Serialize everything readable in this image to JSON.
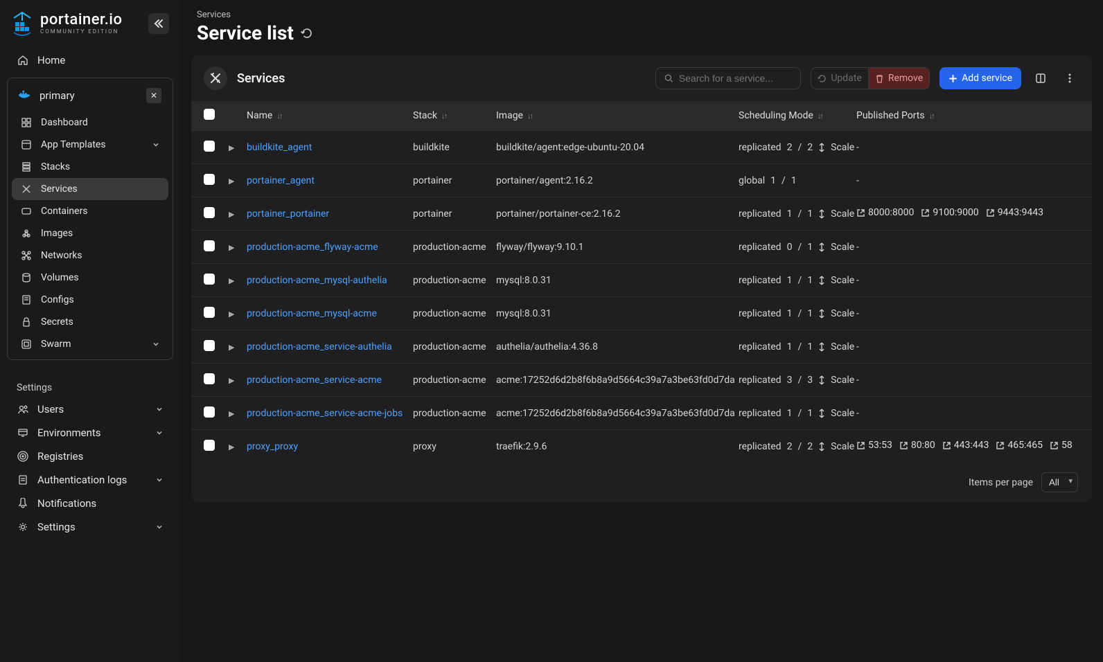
{
  "brand": {
    "name": "portainer.io",
    "tagline": "COMMUNITY EDITION"
  },
  "sidebar": {
    "home": "Home",
    "environment_name": "primary",
    "items": [
      {
        "label": "Dashboard"
      },
      {
        "label": "App Templates",
        "expandable": true
      },
      {
        "label": "Stacks"
      },
      {
        "label": "Services",
        "active": true
      },
      {
        "label": "Containers"
      },
      {
        "label": "Images"
      },
      {
        "label": "Networks"
      },
      {
        "label": "Volumes"
      },
      {
        "label": "Configs"
      },
      {
        "label": "Secrets"
      },
      {
        "label": "Swarm",
        "expandable": true
      }
    ],
    "settings_label": "Settings",
    "settings_items": [
      {
        "label": "Users",
        "expandable": true
      },
      {
        "label": "Environments",
        "expandable": true
      },
      {
        "label": "Registries"
      },
      {
        "label": "Authentication logs",
        "expandable": true
      },
      {
        "label": "Notifications"
      },
      {
        "label": "Settings",
        "expandable": true
      }
    ]
  },
  "breadcrumb": "Services",
  "page_title": "Service list",
  "panel": {
    "title": "Services",
    "search_placeholder": "Search for a service...",
    "update_label": "Update",
    "remove_label": "Remove",
    "add_label": "Add service"
  },
  "columns": {
    "name": "Name",
    "stack": "Stack",
    "image": "Image",
    "mode": "Scheduling Mode",
    "ports": "Published Ports"
  },
  "scale_label": "Scale",
  "rows": [
    {
      "name": "buildkite_agent",
      "stack": "buildkite",
      "image": "buildkite/agent:edge-ubuntu-20.04",
      "mode": "replicated",
      "running": "2",
      "desired": "2",
      "scale": true,
      "ports": []
    },
    {
      "name": "portainer_agent",
      "stack": "portainer",
      "image": "portainer/agent:2.16.2",
      "mode": "global",
      "running": "1",
      "desired": "1",
      "scale": false,
      "ports": []
    },
    {
      "name": "portainer_portainer",
      "stack": "portainer",
      "image": "portainer/portainer-ce:2.16.2",
      "mode": "replicated",
      "running": "1",
      "desired": "1",
      "scale": true,
      "ports": [
        "8000:8000",
        "9100:9000",
        "9443:9443"
      ]
    },
    {
      "name": "production-acme_flyway-acme",
      "stack": "production-acme",
      "image": "flyway/flyway:9.10.1",
      "mode": "replicated",
      "running": "0",
      "desired": "1",
      "scale": true,
      "ports": []
    },
    {
      "name": "production-acme_mysql-authelia",
      "stack": "production-acme",
      "image": "mysql:8.0.31",
      "mode": "replicated",
      "running": "1",
      "desired": "1",
      "scale": true,
      "ports": []
    },
    {
      "name": "production-acme_mysql-acme",
      "stack": "production-acme",
      "image": "mysql:8.0.31",
      "mode": "replicated",
      "running": "1",
      "desired": "1",
      "scale": true,
      "ports": []
    },
    {
      "name": "production-acme_service-authelia",
      "stack": "production-acme",
      "image": "authelia/authelia:4.36.8",
      "mode": "replicated",
      "running": "1",
      "desired": "1",
      "scale": true,
      "ports": []
    },
    {
      "name": "production-acme_service-acme",
      "stack": "production-acme",
      "image": "acme:17252d6d2b8f6b8a9d5664c39a7a3be63fd0d7da",
      "mode": "replicated",
      "running": "3",
      "desired": "3",
      "scale": true,
      "ports": []
    },
    {
      "name": "production-acme_service-acme-jobs",
      "stack": "production-acme",
      "image": "acme:17252d6d2b8f6b8a9d5664c39a7a3be63fd0d7da",
      "mode": "replicated",
      "running": "1",
      "desired": "1",
      "scale": true,
      "ports": []
    },
    {
      "name": "proxy_proxy",
      "stack": "proxy",
      "image": "traefik:2.9.6",
      "mode": "replicated",
      "running": "2",
      "desired": "2",
      "scale": true,
      "ports": [
        "53:53",
        "80:80",
        "443:443",
        "465:465",
        "58"
      ]
    }
  ],
  "footer": {
    "items_per_page": "Items per page",
    "selected": "All"
  }
}
